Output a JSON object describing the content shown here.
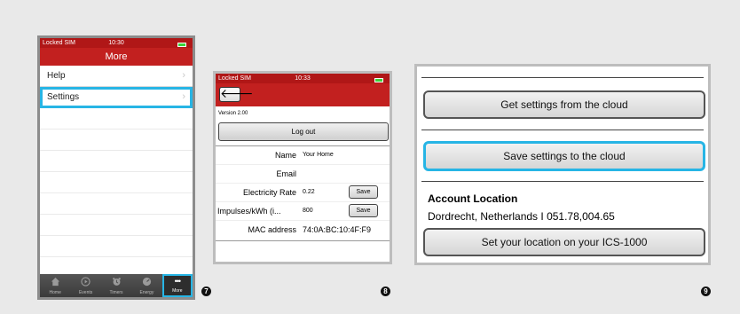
{
  "screen1": {
    "status": {
      "carrier": "Locked SIM",
      "time": "10:30"
    },
    "title": "More",
    "items": [
      {
        "label": "Help",
        "chevron": "›"
      },
      {
        "label": "Settings",
        "chevron": "›"
      }
    ],
    "tabs": [
      {
        "label": "Home",
        "icon": "home-icon"
      },
      {
        "label": "Events",
        "icon": "play-circle-icon"
      },
      {
        "label": "Timers",
        "icon": "alarm-clock-icon"
      },
      {
        "label": "Energy",
        "icon": "gauge-icon"
      },
      {
        "label": "More",
        "icon": "more-dots-icon",
        "glyph": "•••"
      }
    ]
  },
  "screen2": {
    "status": {
      "carrier": "Locked SIM",
      "time": "10:33"
    },
    "back_glyph": "🡐",
    "version": "Version 2.00",
    "logout": "Log out",
    "name_label": "Name",
    "name_value": "Your Home",
    "email_label": "Email",
    "rate_label": "Electricity Rate",
    "rate_value": "0.22",
    "impulses_label": "Impulses/kWh (i...",
    "impulses_value": "800",
    "save_label": "Save",
    "mac_label": "MAC address",
    "mac_value": "74:0A:BC:10:4F:F9"
  },
  "screen3": {
    "get_button": "Get settings from the cloud",
    "save_button": "Save settings to the cloud",
    "account_heading": "Account Location",
    "account_value": "Dordrecht, Netherlands I 051.78,004.65",
    "set_location_button": "Set your location on your ICS-1000"
  },
  "markers": [
    "7",
    "8",
    "9"
  ],
  "colors": {
    "header_red": "#c2201f",
    "highlight_blue": "#27b5e5"
  }
}
